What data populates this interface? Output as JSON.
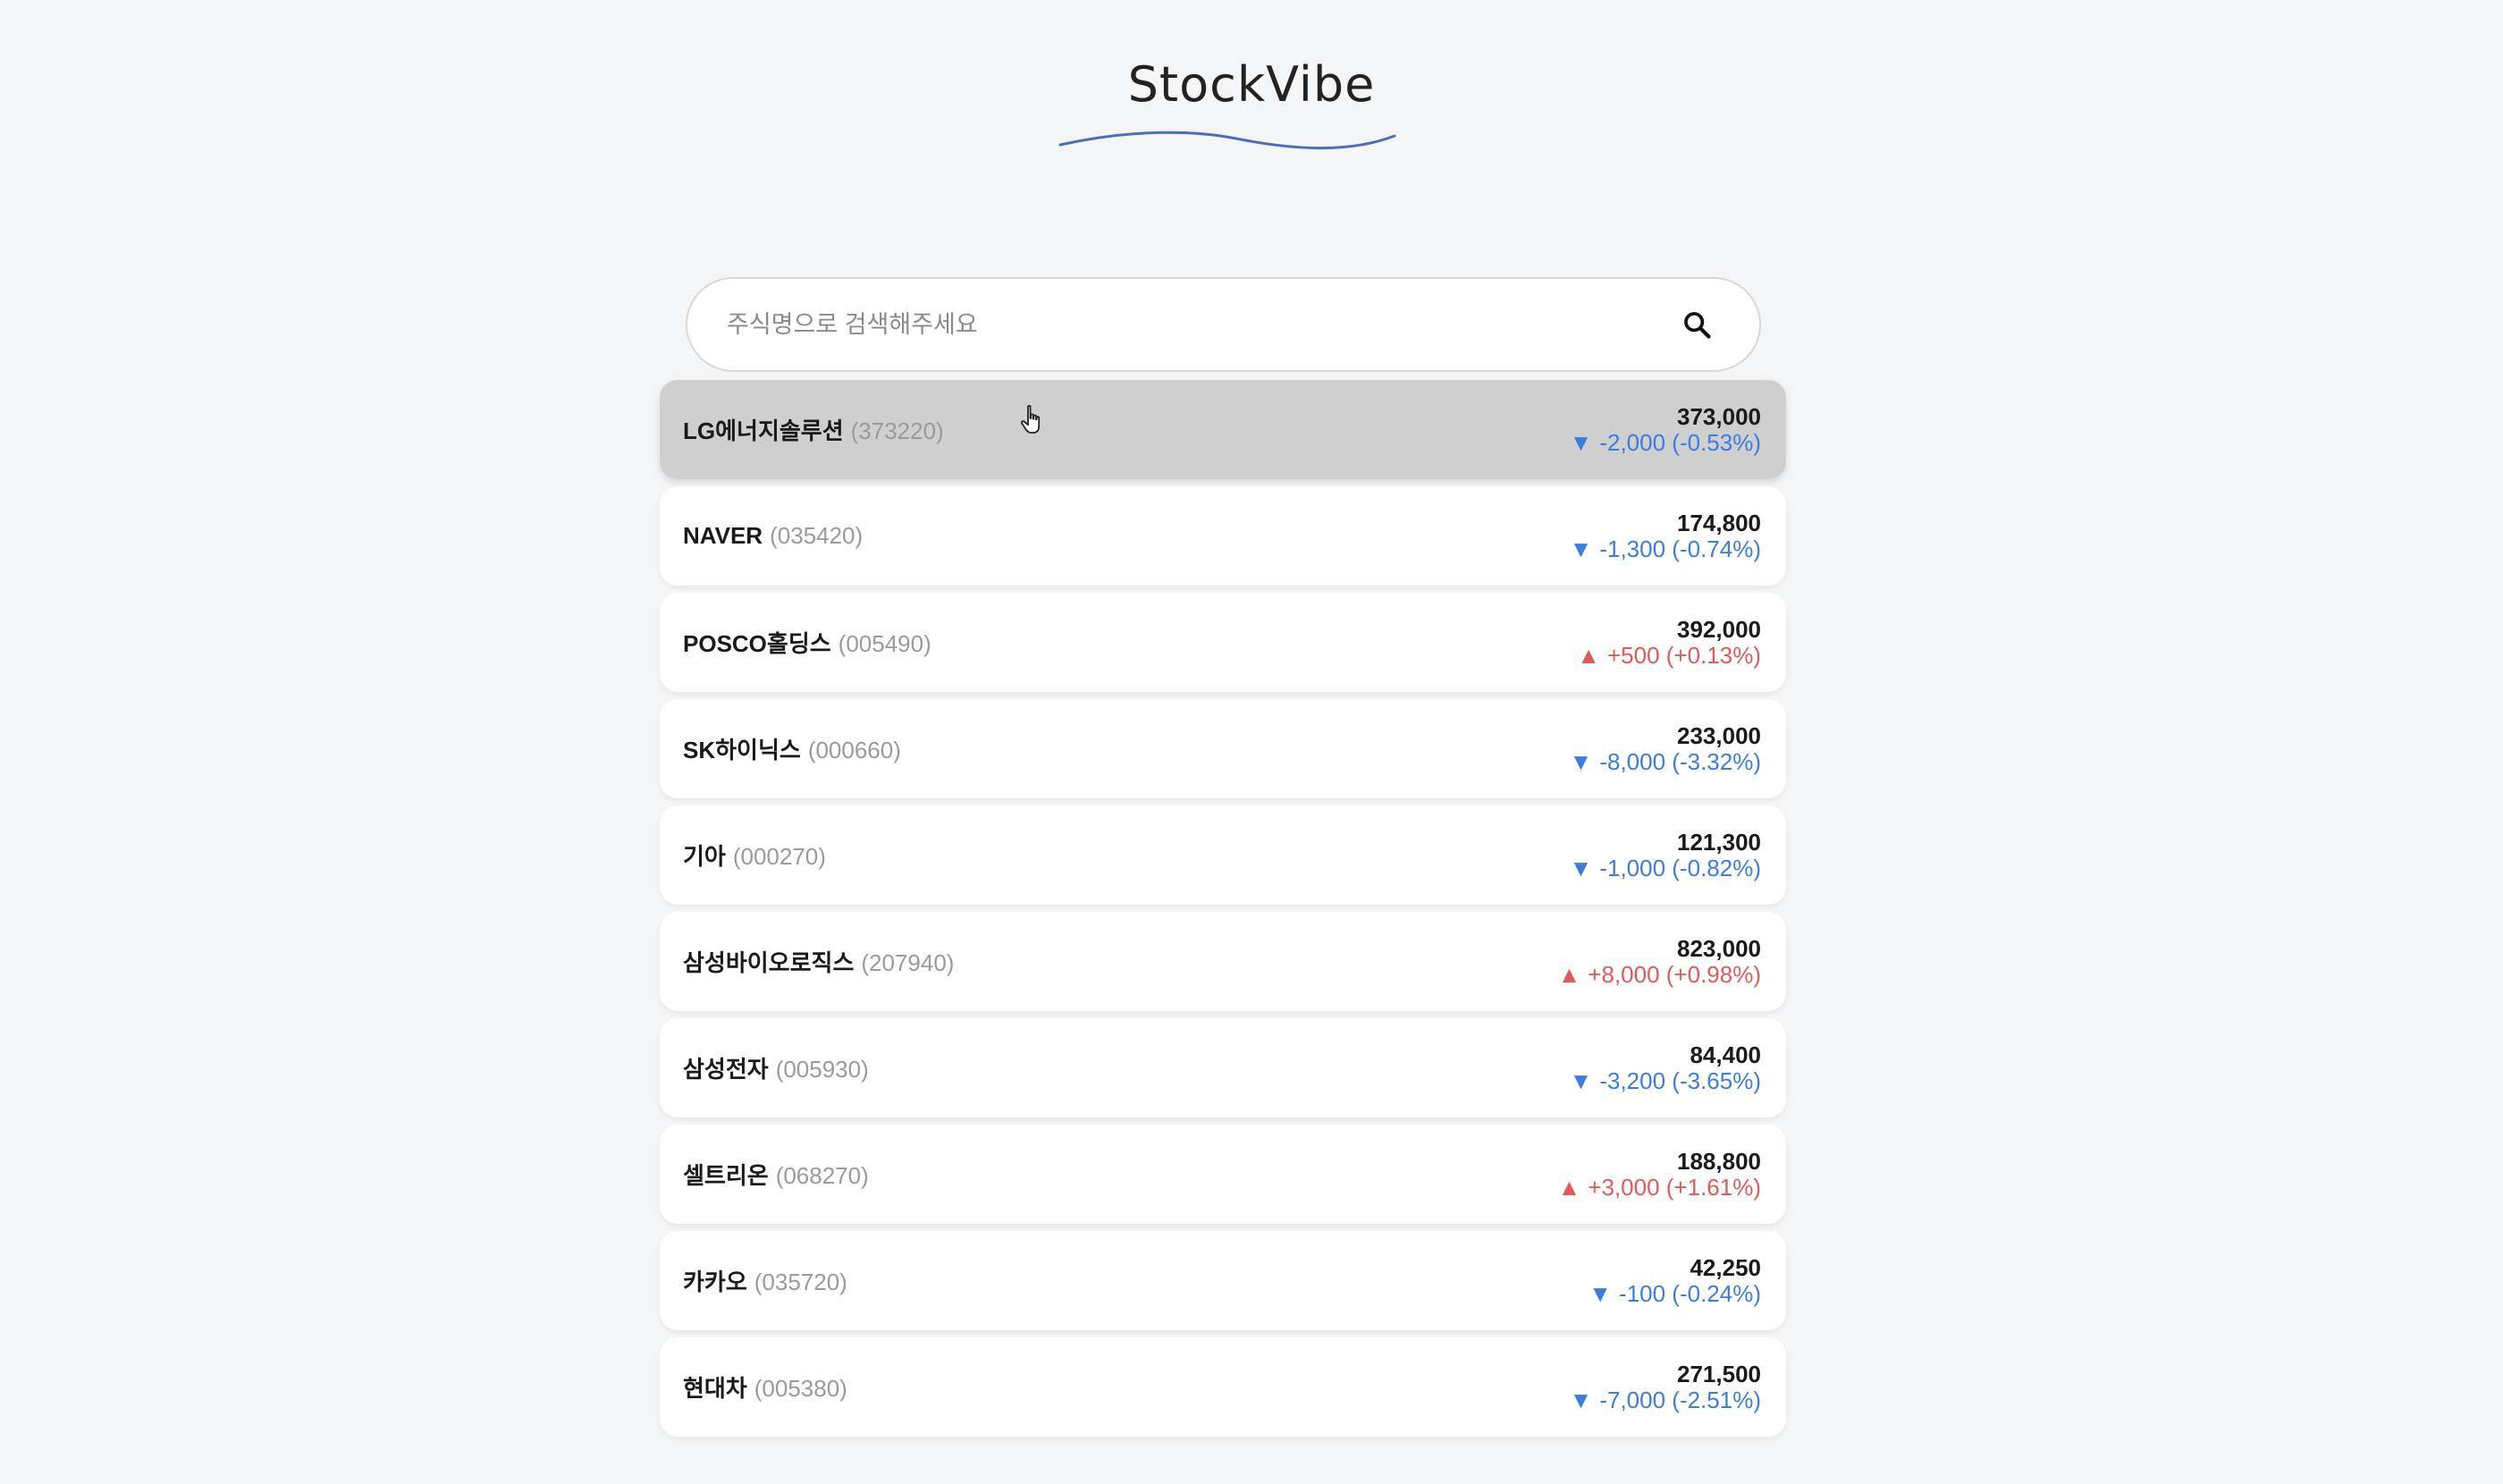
{
  "app": {
    "title": "StockVibe"
  },
  "search": {
    "placeholder": "주식명으로 검색해주세요",
    "value": ""
  },
  "colors": {
    "background": "#f4f5f7",
    "down": "#3b7ddd",
    "up": "#e05a5a",
    "wave": "#4a6fb8",
    "hover": "#cfcfcf"
  },
  "stocks": [
    {
      "name": "LG에너지솔루션",
      "code": "(373220)",
      "price": "373,000",
      "arrow": "▼",
      "change": "-2,000 (-0.53%)",
      "direction": "down",
      "hovered": true
    },
    {
      "name": "NAVER",
      "code": "(035420)",
      "price": "174,800",
      "arrow": "▼",
      "change": "-1,300 (-0.74%)",
      "direction": "down",
      "hovered": false
    },
    {
      "name": "POSCO홀딩스",
      "code": "(005490)",
      "price": "392,000",
      "arrow": "▲",
      "change": "+500 (+0.13%)",
      "direction": "up",
      "hovered": false
    },
    {
      "name": "SK하이닉스",
      "code": "(000660)",
      "price": "233,000",
      "arrow": "▼",
      "change": "-8,000 (-3.32%)",
      "direction": "down",
      "hovered": false
    },
    {
      "name": "기아",
      "code": "(000270)",
      "price": "121,300",
      "arrow": "▼",
      "change": "-1,000 (-0.82%)",
      "direction": "down",
      "hovered": false
    },
    {
      "name": "삼성바이오로직스",
      "code": "(207940)",
      "price": "823,000",
      "arrow": "▲",
      "change": "+8,000 (+0.98%)",
      "direction": "up",
      "hovered": false
    },
    {
      "name": "삼성전자",
      "code": "(005930)",
      "price": "84,400",
      "arrow": "▼",
      "change": "-3,200 (-3.65%)",
      "direction": "down",
      "hovered": false
    },
    {
      "name": "셀트리온",
      "code": "(068270)",
      "price": "188,800",
      "arrow": "▲",
      "change": "+3,000 (+1.61%)",
      "direction": "up",
      "hovered": false
    },
    {
      "name": "카카오",
      "code": "(035720)",
      "price": "42,250",
      "arrow": "▼",
      "change": "-100 (-0.24%)",
      "direction": "down",
      "hovered": false
    },
    {
      "name": "현대차",
      "code": "(005380)",
      "price": "271,500",
      "arrow": "▼",
      "change": "-7,000 (-2.51%)",
      "direction": "down",
      "hovered": false
    }
  ]
}
